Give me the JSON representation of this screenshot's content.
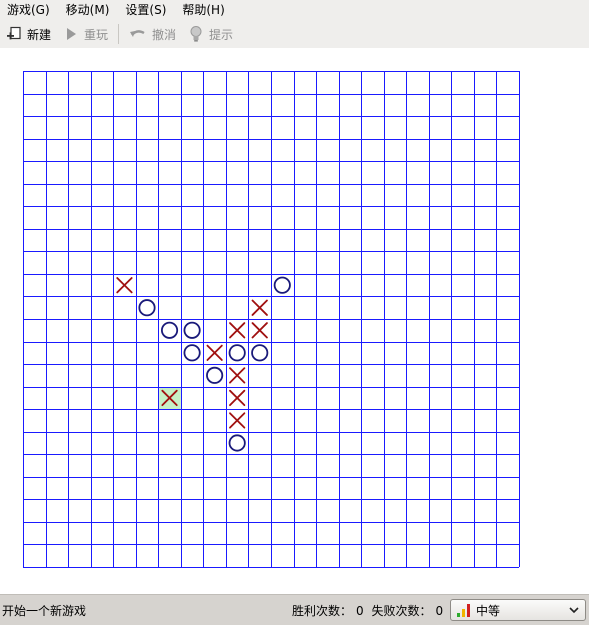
{
  "menu": [
    {
      "label": "游戏(G)"
    },
    {
      "label": "移动(M)"
    },
    {
      "label": "设置(S)"
    },
    {
      "label": "帮助(H)"
    }
  ],
  "toolbar": {
    "new_label": "新建",
    "replay_label": "重玩",
    "undo_label": "撤消",
    "hint_label": "提示"
  },
  "board": {
    "columns": 22,
    "rows": 22,
    "grid_color": "#1a1aff",
    "x_color": "#a01010",
    "o_color": "#1a1a7a",
    "highlight_color": "#c6f0c6",
    "stones": [
      {
        "col": 4,
        "row": 9,
        "mark": "X"
      },
      {
        "col": 5,
        "row": 10,
        "mark": "O"
      },
      {
        "col": 6,
        "row": 11,
        "mark": "O"
      },
      {
        "col": 7,
        "row": 11,
        "mark": "O"
      },
      {
        "col": 7,
        "row": 12,
        "mark": "O"
      },
      {
        "col": 8,
        "row": 12,
        "mark": "X"
      },
      {
        "col": 8,
        "row": 13,
        "mark": "O"
      },
      {
        "col": 9,
        "row": 11,
        "mark": "X"
      },
      {
        "col": 9,
        "row": 12,
        "mark": "O"
      },
      {
        "col": 9,
        "row": 13,
        "mark": "X"
      },
      {
        "col": 9,
        "row": 14,
        "mark": "X"
      },
      {
        "col": 9,
        "row": 15,
        "mark": "X"
      },
      {
        "col": 9,
        "row": 16,
        "mark": "O"
      },
      {
        "col": 10,
        "row": 10,
        "mark": "X"
      },
      {
        "col": 10,
        "row": 11,
        "mark": "X"
      },
      {
        "col": 10,
        "row": 12,
        "mark": "O"
      },
      {
        "col": 11,
        "row": 9,
        "mark": "O"
      },
      {
        "col": 6,
        "row": 14,
        "mark": "X",
        "highlight": true
      }
    ]
  },
  "status": {
    "message": "开始一个新游戏",
    "wins_label": "胜利次数：",
    "wins": "0",
    "losses_label": "失败次数：",
    "losses": "0",
    "difficulty": "中等"
  }
}
